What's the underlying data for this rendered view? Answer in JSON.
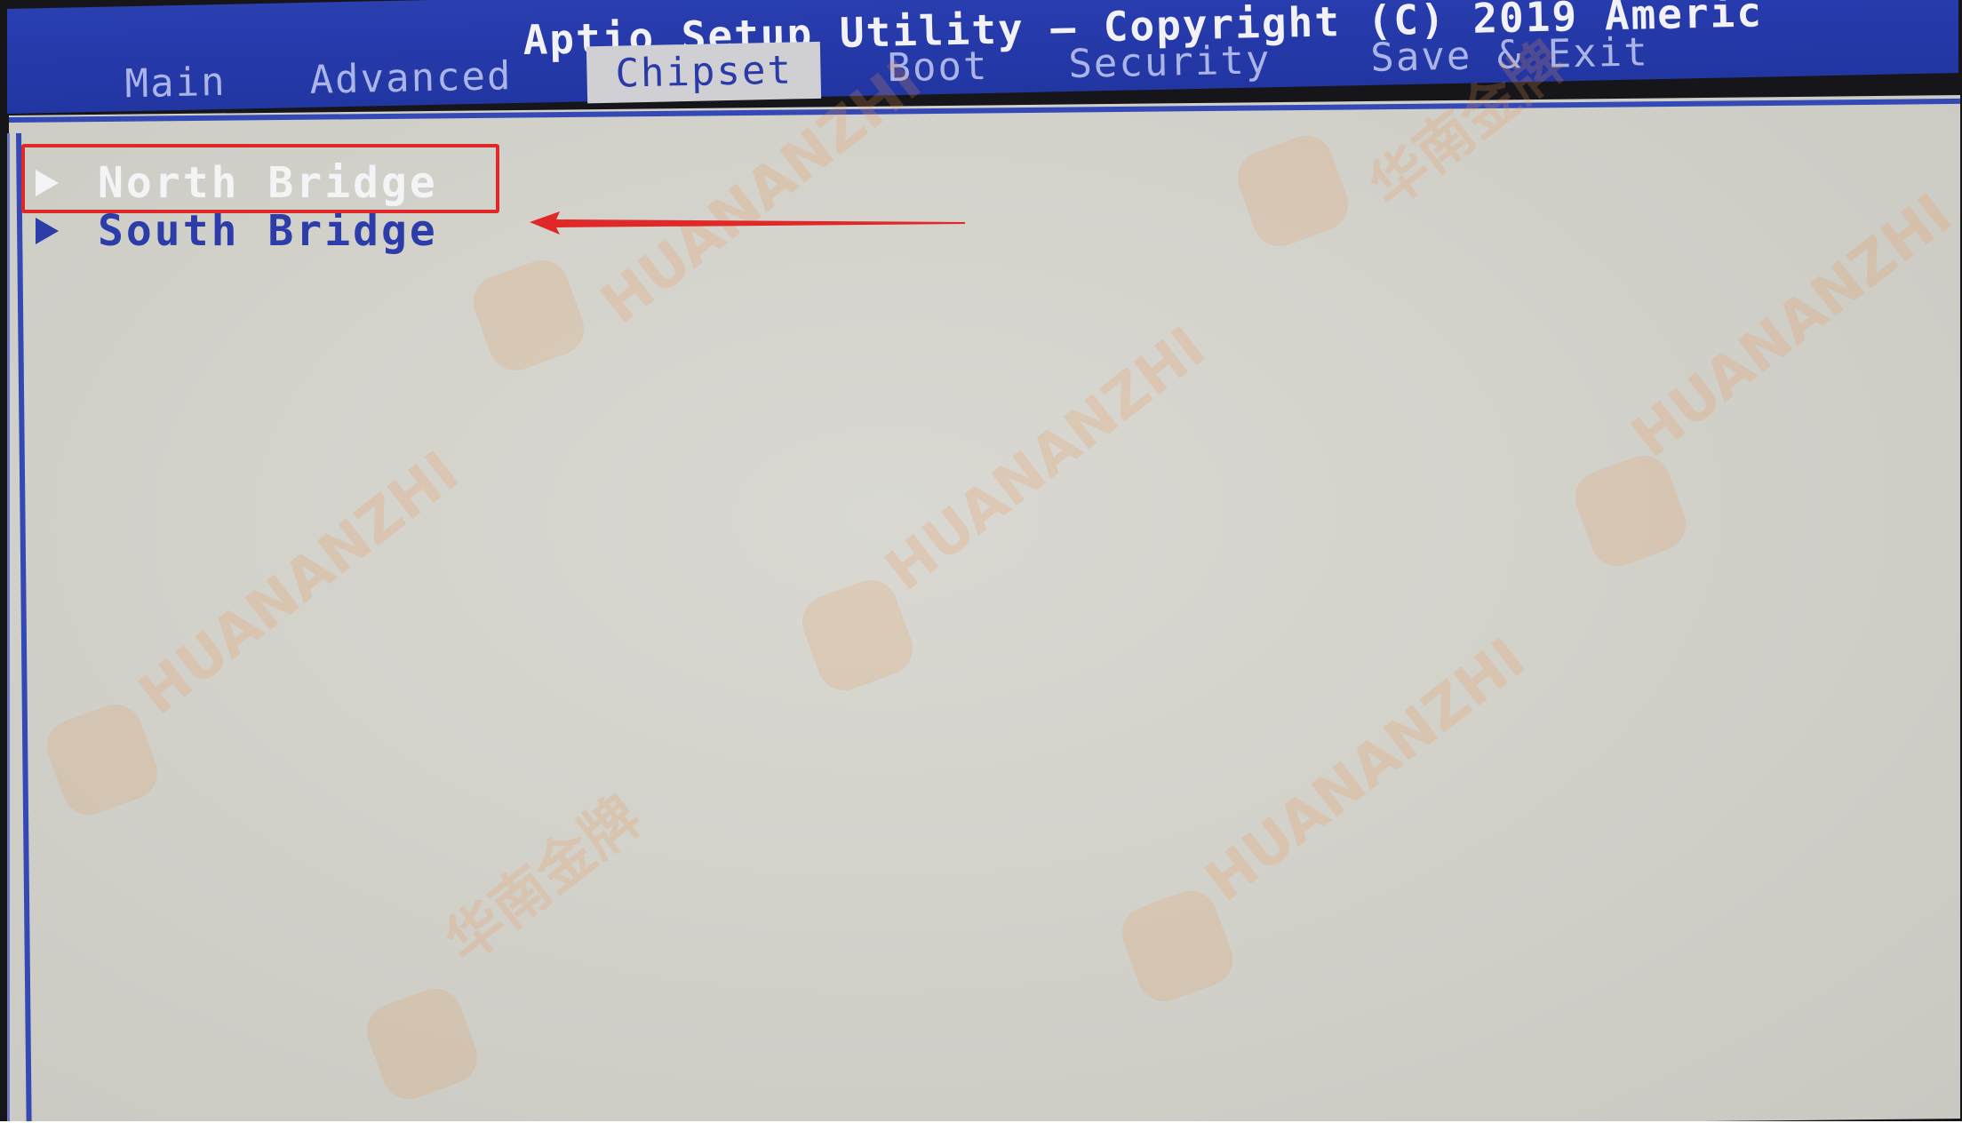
{
  "header": {
    "title": "Aptio Setup Utility – Copyright (C) 2019 Americ"
  },
  "tabs": [
    {
      "label": "Main",
      "active": false
    },
    {
      "label": "Advanced",
      "active": false
    },
    {
      "label": "Chipset",
      "active": true
    },
    {
      "label": "Boot",
      "active": false
    },
    {
      "label": "Security",
      "active": false
    },
    {
      "label": "Save & Exit",
      "active": false
    }
  ],
  "menu": {
    "items": [
      {
        "label": "North Bridge",
        "selected": true
      },
      {
        "label": "South Bridge",
        "selected": false
      }
    ]
  },
  "watermark": {
    "brand_en": "HUANANZHI",
    "brand_cn": "华南金牌"
  },
  "colors": {
    "header_blue": "#2438a8",
    "panel_grey": "#d3d2cb",
    "annotation_red": "#e02828",
    "highlight_text": "#f4f4f6",
    "item_blue": "#2c3ca8"
  }
}
